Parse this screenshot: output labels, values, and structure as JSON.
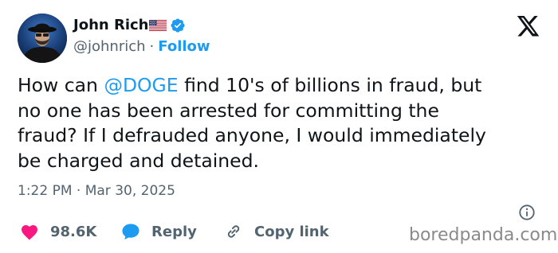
{
  "author": {
    "name": "John Rich",
    "flag_emoji": "🇺🇸",
    "handle": "@johnrich",
    "separator": "·",
    "follow_label": "Follow",
    "verified": true,
    "avatar_icon": "avatar-photo"
  },
  "platform": {
    "logo_icon": "x-logo-icon"
  },
  "tweet": {
    "text_before_mention": "How can ",
    "mention": "@DOGE",
    "text_after_mention": " find 10's of billions in fraud, but\nno one has been arrested for committing the\nfraud? If I defrauded anyone, I would immediately\nbe charged and detained.",
    "timestamp": "1:22 PM · Mar 30, 2025"
  },
  "actions": {
    "like_count": "98.6K",
    "reply_label": "Reply",
    "copy_link_label": "Copy link"
  },
  "watermark": "boredpanda.com",
  "colors": {
    "accent": "#1d9bf0",
    "like": "#f91880",
    "text": "#0f1419",
    "secondary": "#536471"
  }
}
